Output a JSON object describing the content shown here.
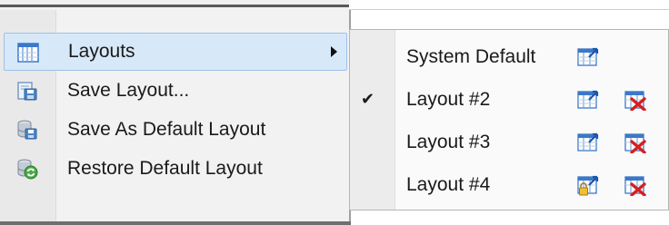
{
  "menu": {
    "items": [
      {
        "label": "Layouts",
        "icon": "layouts-grid-icon",
        "active": true,
        "has_submenu": true
      },
      {
        "label": "Save Layout...",
        "icon": "save-layout-icon"
      },
      {
        "label": "Save As Default Layout",
        "icon": "save-default-layout-icon"
      },
      {
        "label": "Restore Default Layout",
        "icon": "restore-default-layout-icon"
      }
    ]
  },
  "submenu": {
    "rows": [
      {
        "label": "System Default",
        "checked": false,
        "actions": [
          "apply-layout-icon"
        ]
      },
      {
        "label": "Layout #2",
        "checked": true,
        "check_glyph": "✔",
        "actions": [
          "apply-layout-icon",
          "delete-layout-icon"
        ]
      },
      {
        "label": "Layout #3",
        "checked": false,
        "actions": [
          "apply-layout-icon",
          "delete-layout-icon"
        ]
      },
      {
        "label": "Layout #4",
        "checked": false,
        "actions": [
          "apply-locked-layout-icon",
          "delete-layout-icon"
        ]
      }
    ]
  },
  "colors": {
    "highlight": "#d7e8f8",
    "highlight_border": "#9cc2ea",
    "delete_red": "#d42020",
    "grid_blue": "#3c78c8"
  }
}
